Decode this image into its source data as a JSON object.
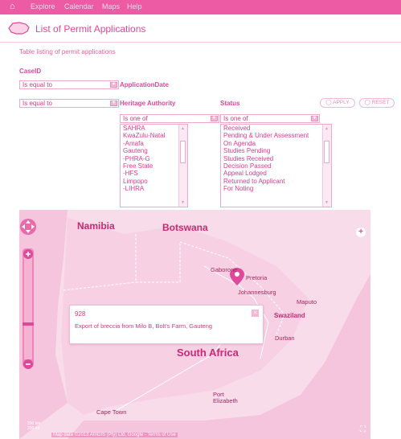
{
  "nav": {
    "home_icon": "home-icon",
    "items": [
      "Explore",
      "Calendar",
      "Maps",
      "Help"
    ]
  },
  "header": {
    "title": "List of Permit Applications",
    "icon": "africa-map-icon"
  },
  "table_caption": "Table listing of permit applications",
  "filters": {
    "caseid_label": "CaseID",
    "caseid_operator": "Is equal to",
    "application_date_label": "ApplicationDate",
    "application_date_operator": "Is equal to",
    "heritage_authority_label": "Heritage Authority",
    "heritage_authority_operator": "Is one of",
    "heritage_authority_options": [
      "SAHRA",
      "KwaZulu-Natal",
      "-Amafa",
      "Gauteng",
      "-PHRA-G",
      "Free State",
      "-HFS",
      "Limpopo",
      "-LIHRA"
    ],
    "status_label": "Status",
    "status_operator": "Is one of",
    "status_options": [
      "Received",
      "Pending & Under Assessment",
      "On Agenda",
      "Studies Pending",
      "Studies Received",
      "Decision Passed",
      "Appeal Lodged",
      "Returned to Applicant",
      "For Noting"
    ],
    "apply_label": "APPLY",
    "reset_label": "RESET"
  },
  "map": {
    "countries": [
      "Namibia",
      "Botswana",
      "South Africa",
      "Swaziland"
    ],
    "cities": [
      "Gaborone",
      "Pretoria",
      "Johannesburg",
      "Maputo",
      "Durban",
      "Port Elizabeth",
      "Cape Town"
    ],
    "popup": {
      "id": "928",
      "description": "Export of breccia from Milo B, Bolt's Farm, Gauteng"
    },
    "attribution": "Map data ©2013 AfriGIS (Pty) Ltd, Google - Terms of Use",
    "scale": [
      "200 km",
      "200 mi"
    ]
  },
  "colors": {
    "accent": "#ec5ba3",
    "text": "#d5317f",
    "map_land": "#f7d7e7"
  }
}
